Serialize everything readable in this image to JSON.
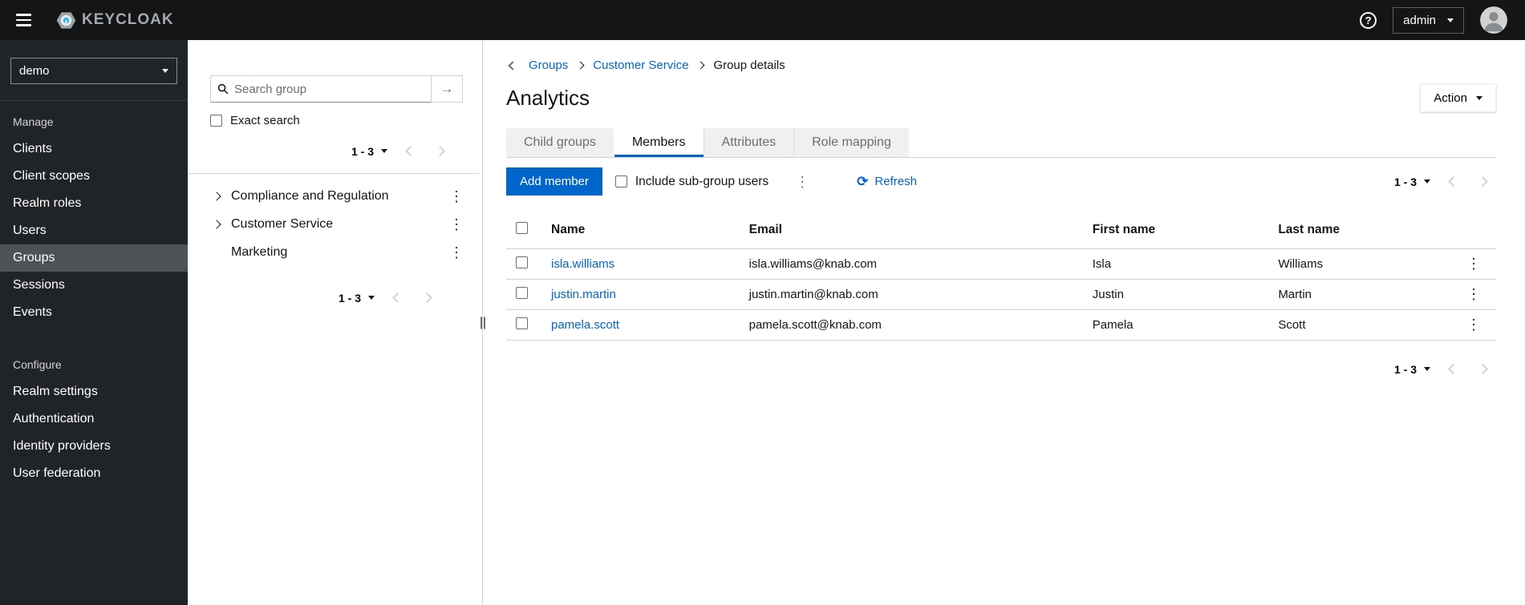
{
  "masthead": {
    "brand": "KEYCLOAK",
    "username": "admin"
  },
  "icons": {
    "help": "?",
    "kebab": "⋮",
    "refresh": "⟳",
    "search_submit": "→"
  },
  "colors": {
    "primary_blue": "#0066cc",
    "link_blue": "#0066cc",
    "masthead_bg": "#151515",
    "sidebar_bg": "#212427",
    "active_nav_bg": "#4f5255",
    "inactive_tab_bg": "#f0f0f0",
    "border_gray": "#d2d2d2"
  },
  "sidebar": {
    "realm_selector": "demo",
    "sections": [
      {
        "title": "Manage",
        "items": [
          {
            "label": "Clients",
            "active": false
          },
          {
            "label": "Client scopes",
            "active": false
          },
          {
            "label": "Realm roles",
            "active": false
          },
          {
            "label": "Users",
            "active": false
          },
          {
            "label": "Groups",
            "active": true
          },
          {
            "label": "Sessions",
            "active": false
          },
          {
            "label": "Events",
            "active": false
          }
        ]
      },
      {
        "title": "Configure",
        "items": [
          {
            "label": "Realm settings",
            "active": false
          },
          {
            "label": "Authentication",
            "active": false
          },
          {
            "label": "Identity providers",
            "active": false
          },
          {
            "label": "User federation",
            "active": false
          }
        ]
      }
    ]
  },
  "groups_panel": {
    "search_placeholder": "Search group",
    "search_value": "",
    "exact_search_label": "Exact search",
    "top_pagination": "1 - 3",
    "bottom_pagination": "1 - 3",
    "tree": [
      {
        "label": "Compliance and Regulation",
        "expandable": true
      },
      {
        "label": "Customer Service",
        "expandable": true
      },
      {
        "label": "Marketing",
        "expandable": false
      }
    ]
  },
  "main": {
    "breadcrumb": {
      "items": [
        {
          "label": "Groups",
          "link": true
        },
        {
          "label": "Customer Service",
          "link": true
        },
        {
          "label": "Group details",
          "link": false
        }
      ]
    },
    "title": "Analytics",
    "action_button": "Action",
    "tabs": [
      {
        "label": "Child groups",
        "active": false
      },
      {
        "label": "Members",
        "active": true
      },
      {
        "label": "Attributes",
        "active": false
      },
      {
        "label": "Role mapping",
        "active": false
      }
    ],
    "toolbar": {
      "add_member": "Add member",
      "include_subgroups": "Include sub-group users",
      "refresh": "Refresh",
      "pagination": "1 - 3"
    },
    "table": {
      "headers": {
        "name": "Name",
        "email": "Email",
        "first_name": "First name",
        "last_name": "Last name"
      },
      "rows": [
        {
          "name": "isla.williams",
          "email": "isla.williams@knab.com",
          "first_name": "Isla",
          "last_name": "Williams"
        },
        {
          "name": "justin.martin",
          "email": "justin.martin@knab.com",
          "first_name": "Justin",
          "last_name": "Martin"
        },
        {
          "name": "pamela.scott",
          "email": "pamela.scott@knab.com",
          "first_name": "Pamela",
          "last_name": "Scott"
        }
      ]
    },
    "bottom_pagination": "1 - 3"
  }
}
